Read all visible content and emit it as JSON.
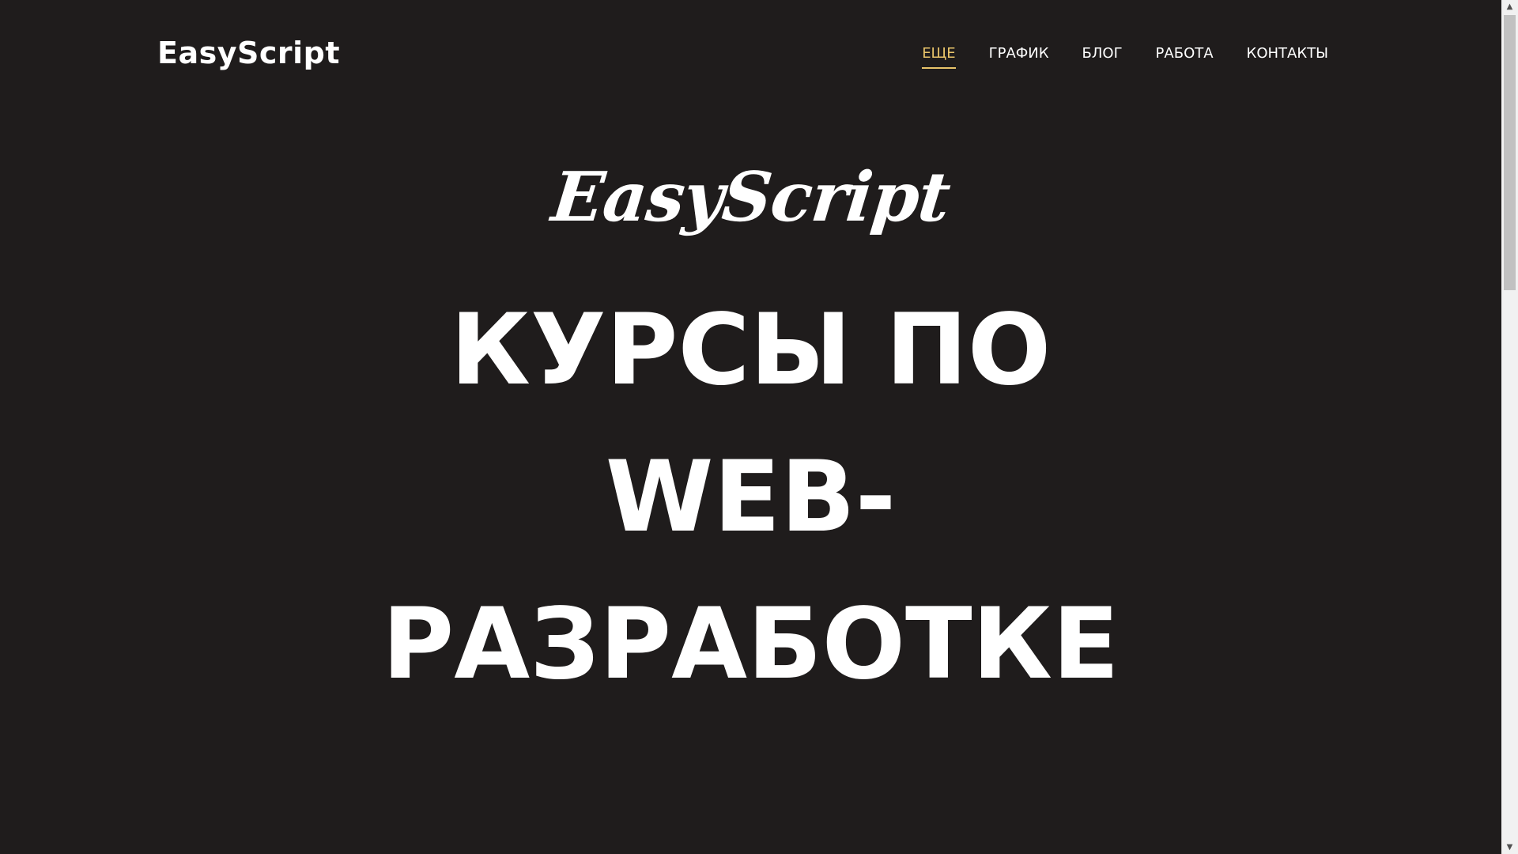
{
  "header": {
    "logo": "EasyScript",
    "nav": [
      {
        "label": "ЕЩЕ",
        "active": true
      },
      {
        "label": "ГРАФИК",
        "active": false
      },
      {
        "label": "БЛОГ",
        "active": false
      },
      {
        "label": "РАБОТА",
        "active": false
      },
      {
        "label": "КОНТАКТЫ",
        "active": false
      }
    ]
  },
  "hero": {
    "script_logo": "EasyScript",
    "title_lines": [
      "КУРСЫ ПО",
      "WEB-",
      "РАЗРАБОТКЕ"
    ]
  },
  "colors": {
    "background": "#1f1c1c",
    "text": "#ffffff",
    "accent": "#e9c46a"
  },
  "icons": {
    "scroll_up": "triangle-up-icon",
    "scroll_down": "triangle-down-icon"
  }
}
